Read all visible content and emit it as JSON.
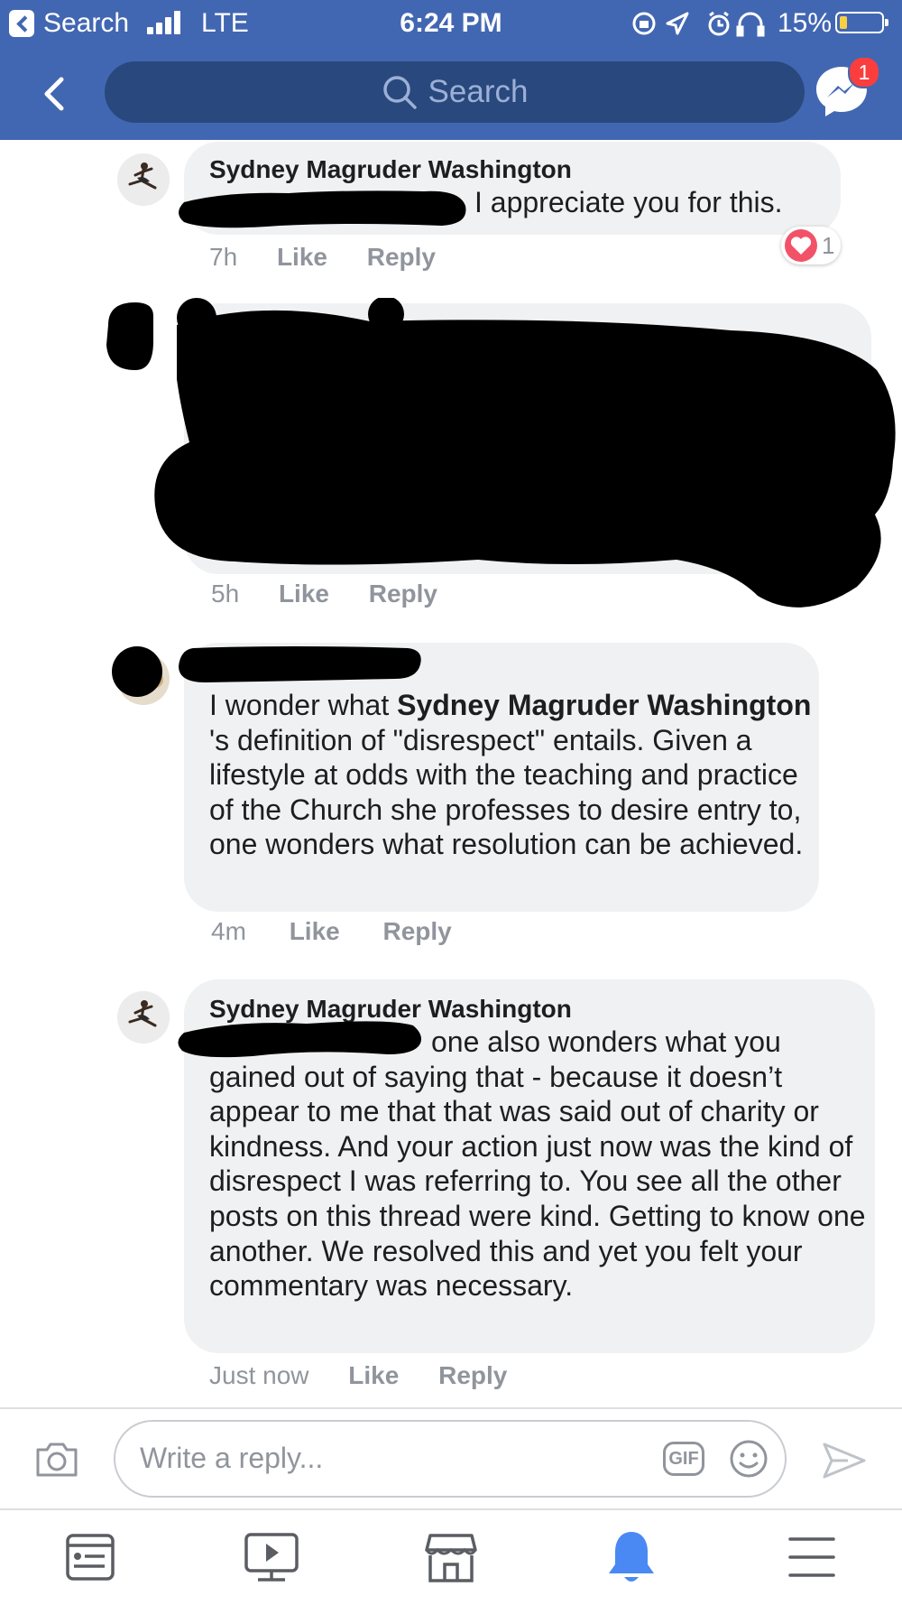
{
  "status_bar": {
    "back_label": "Search",
    "network": "LTE",
    "time": "6:24 PM",
    "battery": "15%",
    "battery_level": 0.15
  },
  "header": {
    "search_placeholder": "Search",
    "messenger_badge": "1"
  },
  "comments": [
    {
      "author": "Sydney Magruder Washington",
      "text": "I appreciate you for this.",
      "time": "7h",
      "like": "Like",
      "reply": "Reply",
      "reaction_count": "1"
    },
    {
      "time": "5h",
      "like": "Like",
      "reply": "Reply"
    },
    {
      "text_prefix": "I wonder what ",
      "mention": "Sydney Magruder Washington",
      "text_suffix": " 's definition of \"disrespect\" entails. Given a lifestyle at odds with the teaching and practice of the Church she professes to desire entry to, one wonders what resolution can be achieved.",
      "time": "4m",
      "like": "Like",
      "reply": "Reply"
    },
    {
      "author": "Sydney Magruder Washington",
      "text": "one also wonders what you gained out of saying that - because it doesn’t appear to me that that was said out of charity or kindness. And your action just now was the kind of disrespect I was referring to. You see all the other posts on this thread were kind. Getting to know one another. We resolved this and yet you felt your commentary was necessary.",
      "time": "Just now",
      "like": "Like",
      "reply": "Reply"
    }
  ],
  "composer": {
    "placeholder": "Write a reply...",
    "gif_label": "GIF"
  },
  "colors": {
    "brand_blue": "#4267b2",
    "active_tab": "#4a89f3",
    "bubble": "#f0f1f2",
    "meta": "#90949c"
  },
  "tab_bar": [
    "news-feed-icon",
    "watch-icon",
    "marketplace-icon",
    "notifications-icon",
    "menu-icon"
  ],
  "active_tab": "notifications-icon"
}
